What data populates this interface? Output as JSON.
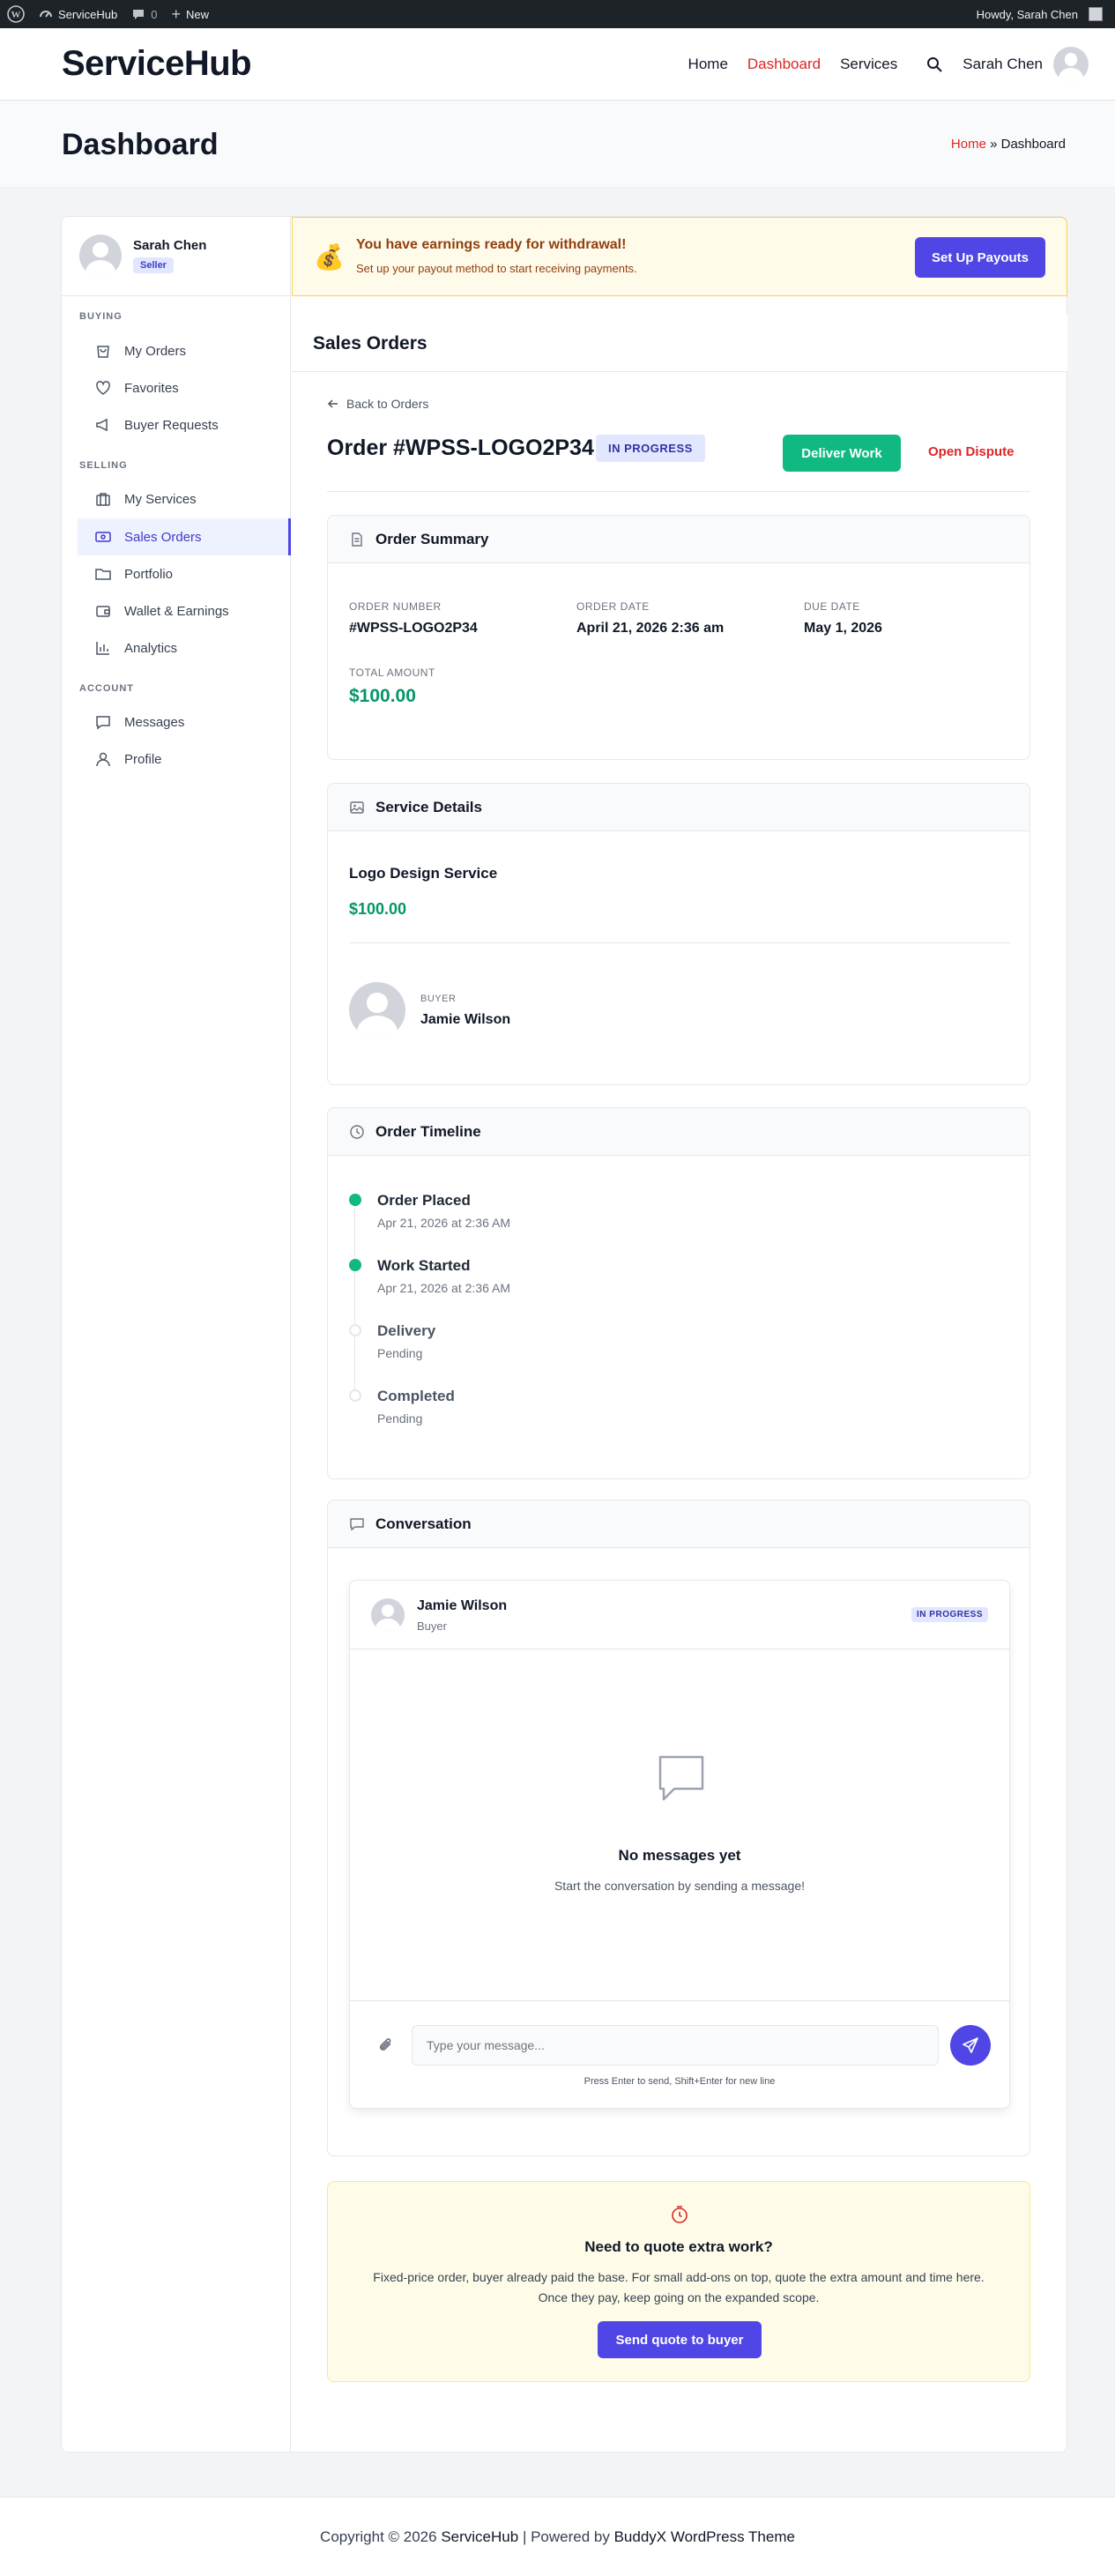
{
  "adminbar": {
    "site_name": "ServiceHub",
    "comments_count": "0",
    "new_label": "New",
    "howdy": "Howdy, Sarah Chen"
  },
  "header": {
    "logo": "ServiceHub",
    "nav": {
      "home": "Home",
      "dashboard": "Dashboard",
      "services": "Services",
      "user_name": "Sarah Chen"
    }
  },
  "page": {
    "title": "Dashboard",
    "breadcrumb_home": "Home",
    "breadcrumb_sep": "»",
    "breadcrumb_current": "Dashboard"
  },
  "sidebar": {
    "user_name": "Sarah Chen",
    "role_badge": "Seller",
    "sections": {
      "buying": "BUYING",
      "selling": "SELLING",
      "account": "ACCOUNT"
    },
    "items": {
      "my_orders": "My Orders",
      "favorites": "Favorites",
      "buyer_requests": "Buyer Requests",
      "my_services": "My Services",
      "sales_orders": "Sales Orders",
      "portfolio": "Portfolio",
      "wallet": "Wallet & Earnings",
      "analytics": "Analytics",
      "messages": "Messages",
      "profile": "Profile"
    }
  },
  "alert": {
    "icon": "money-bag-icon",
    "title": "You have earnings ready for withdrawal!",
    "text": "Set up your payout method to start receiving payments.",
    "button": "Set Up Payouts"
  },
  "section_title": "Sales Orders",
  "order": {
    "back": "Back to Orders",
    "title": "Order #WPSS-LOGO2P34",
    "status": "IN PROGRESS",
    "deliver_button": "Deliver Work",
    "dispute_button": "Open Dispute"
  },
  "summary": {
    "heading": "Order Summary",
    "order_number_label": "ORDER NUMBER",
    "order_number": "#WPSS-LOGO2P34",
    "order_date_label": "ORDER DATE",
    "order_date": "April 21, 2026 2:36 am",
    "due_date_label": "DUE DATE",
    "due_date": "May 1, 2026",
    "total_label": "TOTAL AMOUNT",
    "total": "$100.00"
  },
  "service": {
    "heading": "Service Details",
    "name": "Logo Design Service",
    "price": "$100.00",
    "buyer_label": "BUYER",
    "buyer_name": "Jamie Wilson"
  },
  "timeline": {
    "heading": "Order Timeline",
    "steps": [
      {
        "title": "Order Placed",
        "sub": "Apr 21, 2026 at 2:36 AM",
        "done": true
      },
      {
        "title": "Work Started",
        "sub": "Apr 21, 2026 at 2:36 AM",
        "done": true
      },
      {
        "title": "Delivery",
        "sub": "Pending",
        "done": false
      },
      {
        "title": "Completed",
        "sub": "Pending",
        "done": false
      }
    ]
  },
  "conversation": {
    "heading": "Conversation",
    "user_name": "Jamie Wilson",
    "user_role": "Buyer",
    "status": "IN PROGRESS",
    "empty_title": "No messages yet",
    "empty_text": "Start the conversation by sending a message!",
    "input_placeholder": "Type your message...",
    "hint": "Press Enter to send, Shift+Enter for new line"
  },
  "quote": {
    "title": "Need to quote extra work?",
    "line1": "Fixed-price order, buyer already paid the base. For small add-ons on top, quote the extra amount and time here.",
    "line2": "Once they pay, keep going on the expanded scope.",
    "button": "Send quote to buyer"
  },
  "footer": {
    "copyright": "Copyright © 2026",
    "site": "ServiceHub",
    "sep": "| Powered by",
    "theme": "BuddyX WordPress Theme"
  },
  "colors": {
    "accent": "#4f46e5",
    "brand_red": "#dc2626",
    "success": "#10b981",
    "money": "#059669"
  }
}
